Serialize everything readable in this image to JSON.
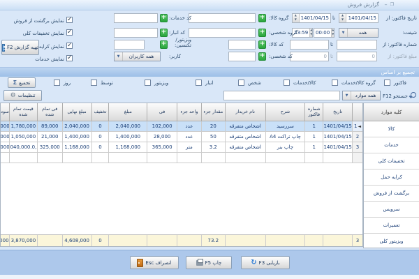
{
  "window": {
    "title": "گزارش فروش"
  },
  "filters": {
    "date_label": "تاریخ فاکتور: از",
    "date_from": "1401/04/15",
    "date_sep": "تا",
    "date_to": "1401/04/15",
    "goods_group_label": "گروه کالا:",
    "goods_group_value": "",
    "services_code_label": "کد خدمات:",
    "services_code_value": "",
    "shift_label": "شیفت:",
    "shift_value": "همه",
    "time_from": "00:00",
    "time_to": "23:59",
    "person_group_label": "گروه شخصی:",
    "person_group_value": "",
    "warehouse_code_label": "کد انبار:",
    "warehouse_code_value": "",
    "invoice_no_label": "شماره فاکتور: از",
    "invoice_no_sep": "تا",
    "invoice_no_from": "",
    "invoice_no_to": "",
    "goods_code_label": "کد کالا:",
    "goods_code_value": "",
    "visitor_label": "ویزیتور/ تکنسین:",
    "visitor_value": "",
    "amount_label": "مبلغ فاکتور: از",
    "amount_sep": "تا",
    "amount_from": "0",
    "amount_to": "0",
    "person_code_label": "کد شخصی:",
    "person_code_value": "",
    "user_label": "کاربر:",
    "user_value": "همه کاربران"
  },
  "display_options": [
    {
      "label": "نمایش برگشت از فروش",
      "checked": true
    },
    {
      "label": "نمایش تخفیفات کلی",
      "checked": true
    },
    {
      "label": "نمایش کرایه حمل",
      "checked": true
    },
    {
      "label": "نمایش خدمات",
      "checked": true
    }
  ],
  "prepare_report_button": "تهیه گزارش F2",
  "aggregate": {
    "header": "تجمیع بر اساس",
    "button": "تجمیع",
    "options": [
      "فاکتور",
      "گروه کالا/خدمات",
      "کالا/خدمات",
      "شخص",
      "انبار",
      "ویزیتور",
      "توسط",
      "روز"
    ]
  },
  "search": {
    "label": "جستجو F12",
    "scope_value": "همه موارد",
    "input_value": "",
    "settings_button": "تنظیمات"
  },
  "sidebar": {
    "header": "کلیه موارد",
    "items": [
      "کالا",
      "خدمات",
      "تخفیفات کلی",
      "کرایه حمل",
      "برگشت از فروش",
      "سرویس",
      "تعمیرات",
      "ویزیتور کلی"
    ]
  },
  "table": {
    "headers": {
      "date": "تاریخ",
      "invoice_no": "شماره فاکتور",
      "desc": "شرح",
      "buyer": "نام خریدار",
      "qty": "مقدار جزء",
      "unit": "واحد جزء",
      "price": "فی",
      "amount": "مبلغ",
      "discount": "تخفیف",
      "final": "مبلغ نهایی",
      "unit_cost": "فی تمام شده",
      "total_cost": "قیمت تمام شده",
      "profit": "سود"
    },
    "rows": [
      {
        "num": "1",
        "date": "1401/04/15",
        "invoice_no": "1",
        "desc": "سررسید",
        "buyer": "اشخاص متفرقه",
        "qty": "20",
        "unit": "عدد",
        "price": "102,000",
        "amount": "2,040,000",
        "discount": "0",
        "final": "2,040,000",
        "unit_cost": "89,000",
        "total_cost": "1,780,000",
        "profit": "000"
      },
      {
        "num": "2",
        "date": "1401/04/15",
        "invoice_no": "1",
        "desc": "چاپ تراکت A4",
        "buyer": "اشخاص متفرقه",
        "qty": "50",
        "unit": "عدد",
        "price": "28,000",
        "amount": "1,400,000",
        "discount": "0",
        "final": "1,400,000",
        "unit_cost": "21,000",
        "total_cost": "1,050,000",
        "profit": "000"
      },
      {
        "num": "3",
        "date": "1401/04/15",
        "invoice_no": "1",
        "desc": "چاپ بنر",
        "buyer": "اشخاص متفرقه",
        "qty": "3.2",
        "unit": "متر",
        "price": "365,000",
        "amount": "1,168,000",
        "discount": "0",
        "final": "1,168,000",
        "unit_cost": "325,000",
        "total_cost": ",040,000.0",
        "profit": "000"
      }
    ],
    "totals": {
      "num": "3",
      "qty": "73.2",
      "discount": "0",
      "final": "4,608,000",
      "total_cost": "3,870,000",
      "profit": ",000"
    }
  },
  "footer": {
    "retrieve_button": "بازیابی F3",
    "print_button": "چاپ F5",
    "cancel_button": "انصراف Esc"
  }
}
